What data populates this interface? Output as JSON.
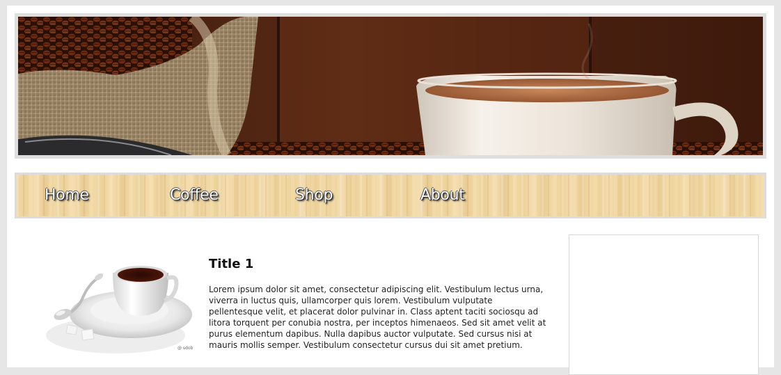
{
  "banner": {
    "image": "coffee-beans-and-cup-banner"
  },
  "nav": {
    "items": [
      {
        "label": "Home"
      },
      {
        "label": "Coffee"
      },
      {
        "label": "Shop"
      },
      {
        "label": "About"
      }
    ]
  },
  "post": {
    "image": "coffee-cup-with-spoon",
    "image_mark": "@ sdob",
    "title": "Title 1",
    "body": "Lorem ipsum dolor sit amet, consectetur adipiscing elit. Vestibulum lectus urna, viverra in luctus quis, ullamcorper quis lorem. Vestibulum vulputate pellentesque velit, et placerat dolor pulvinar in. Class aptent taciti sociosqu ad litora torquent per conubia nostra, per inceptos himenaeos. Sed sit amet velit at purus elementum dapibus. Nulla dapibus auctor vulputate. Sed cursus nisi at mauris mollis semper. Vestibulum consectetur cursus dui sit amet pretium."
  },
  "colors": {
    "page_background": "#e6e6e6",
    "content_background": "#ffffff",
    "frame_gray": "#dedede",
    "nav_wood": "#f1d9a6",
    "nav_text": "#ffffff"
  }
}
